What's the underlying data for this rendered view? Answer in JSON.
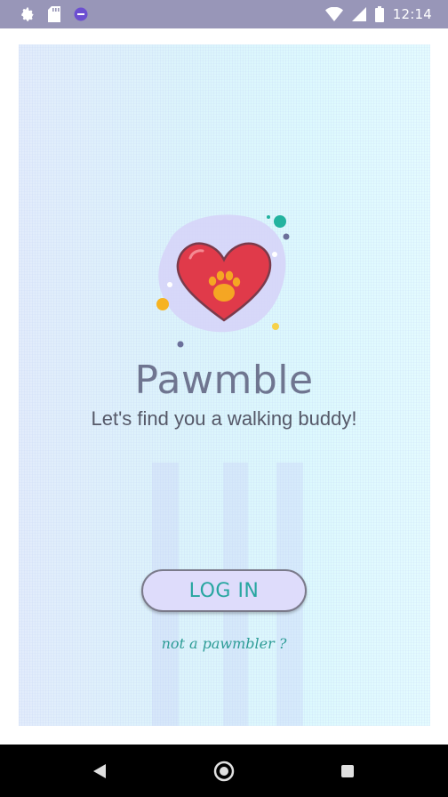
{
  "status_bar": {
    "time": "12:14",
    "left_icons": [
      "settings-icon",
      "sd-card-icon",
      "shield-icon"
    ],
    "right_icons": [
      "wifi-icon",
      "signal-icon",
      "battery-icon"
    ],
    "background": "#9896b8"
  },
  "app": {
    "title": "Pawmble",
    "tagline": "Let's find you a walking buddy!",
    "logo_icon": "heart-paw-icon"
  },
  "actions": {
    "login_label": "LOG IN",
    "signup_link": "not a pawmbler ?"
  },
  "colors": {
    "accent": "#27a6a0",
    "button_fill": "#dedcfb",
    "heart": "#e03a4a",
    "paw": "#f5a623",
    "title": "#6f7590"
  },
  "nav_bar": {
    "buttons": [
      "back-icon",
      "home-icon",
      "recents-icon"
    ]
  }
}
